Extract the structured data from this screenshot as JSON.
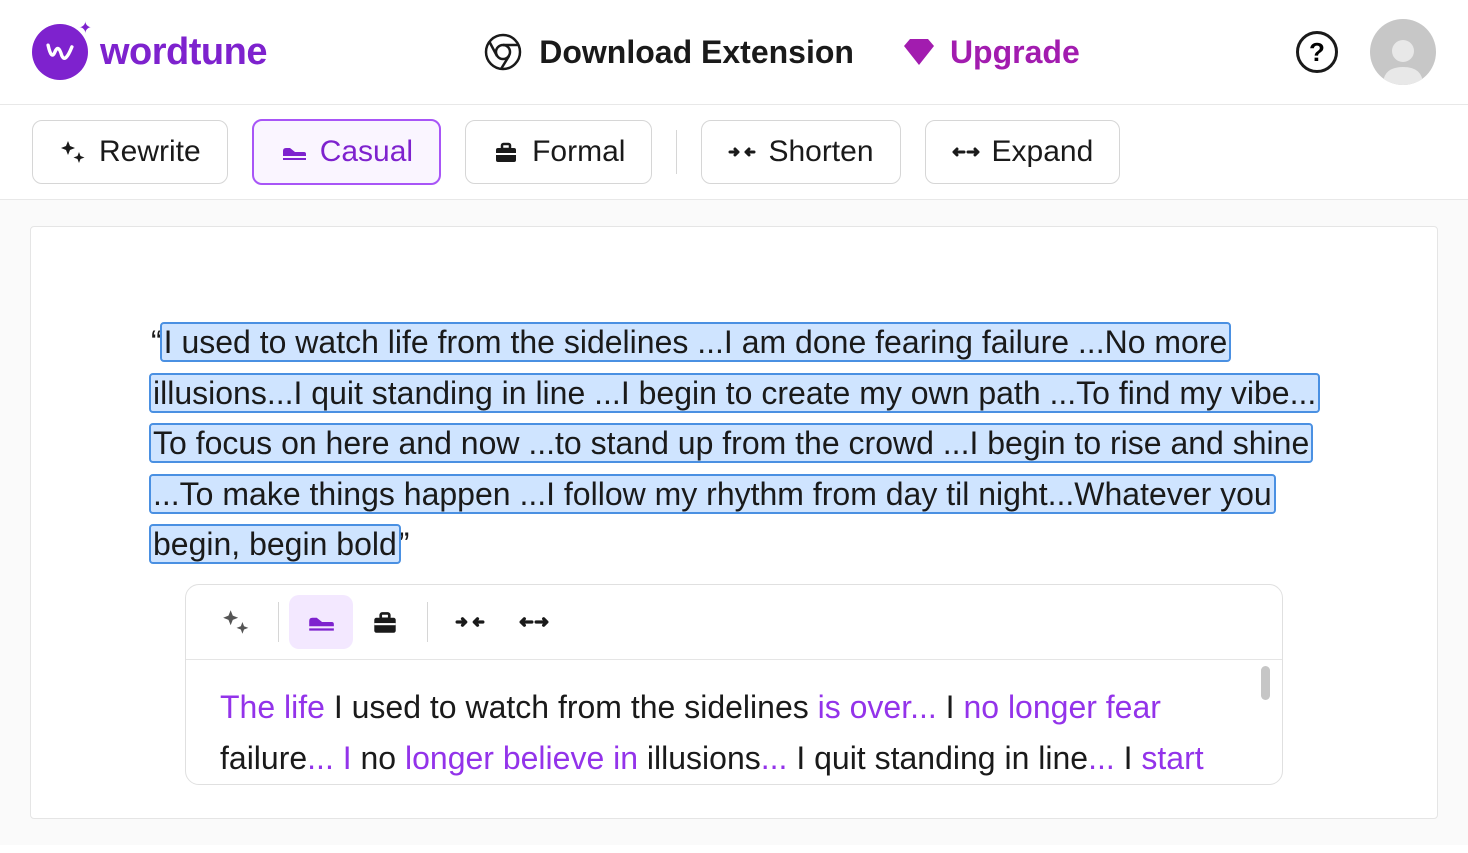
{
  "brand": {
    "name": "wordtune"
  },
  "header": {
    "download_label": "Download Extension",
    "upgrade_label": "Upgrade",
    "help_label": "?"
  },
  "toolbar": {
    "rewrite": "Rewrite",
    "casual": "Casual",
    "formal": "Formal",
    "shorten": "Shorten",
    "expand": "Expand"
  },
  "editor": {
    "quote_open": "“",
    "quote_close": "”",
    "selected_text": "I used to watch life from the sidelines ...I am done fearing failure ...No more illusions...I quit standing in line ...I begin to create my own path ...To find my vibe... To focus on here and now ...to stand up from the crowd ...I begin to rise and shine ...To make things happen ...I follow my rhythm from day til night...Whatever you begin, begin bold"
  },
  "suggestion": {
    "segments": [
      {
        "t": "The life",
        "hi": true
      },
      {
        "t": " I used to watch from the sidelines ",
        "hi": false
      },
      {
        "t": "is over...",
        "hi": true
      },
      {
        "t": " I ",
        "hi": false
      },
      {
        "t": "no longer fear",
        "hi": true
      },
      {
        "t": " failure",
        "hi": false
      },
      {
        "t": "... I",
        "hi": true
      },
      {
        "t": " no ",
        "hi": false
      },
      {
        "t": "longer believe in",
        "hi": true
      },
      {
        "t": " illusions",
        "hi": false
      },
      {
        "t": "...",
        "hi": true
      },
      {
        "t": " I quit standing in line",
        "hi": false
      },
      {
        "t": "...",
        "hi": true
      },
      {
        "t": " I ",
        "hi": false
      },
      {
        "t": "start",
        "hi": true
      }
    ]
  },
  "colors": {
    "brand": "#7e22ce",
    "accent": "#a855f7",
    "highlight": "#9333ea"
  }
}
